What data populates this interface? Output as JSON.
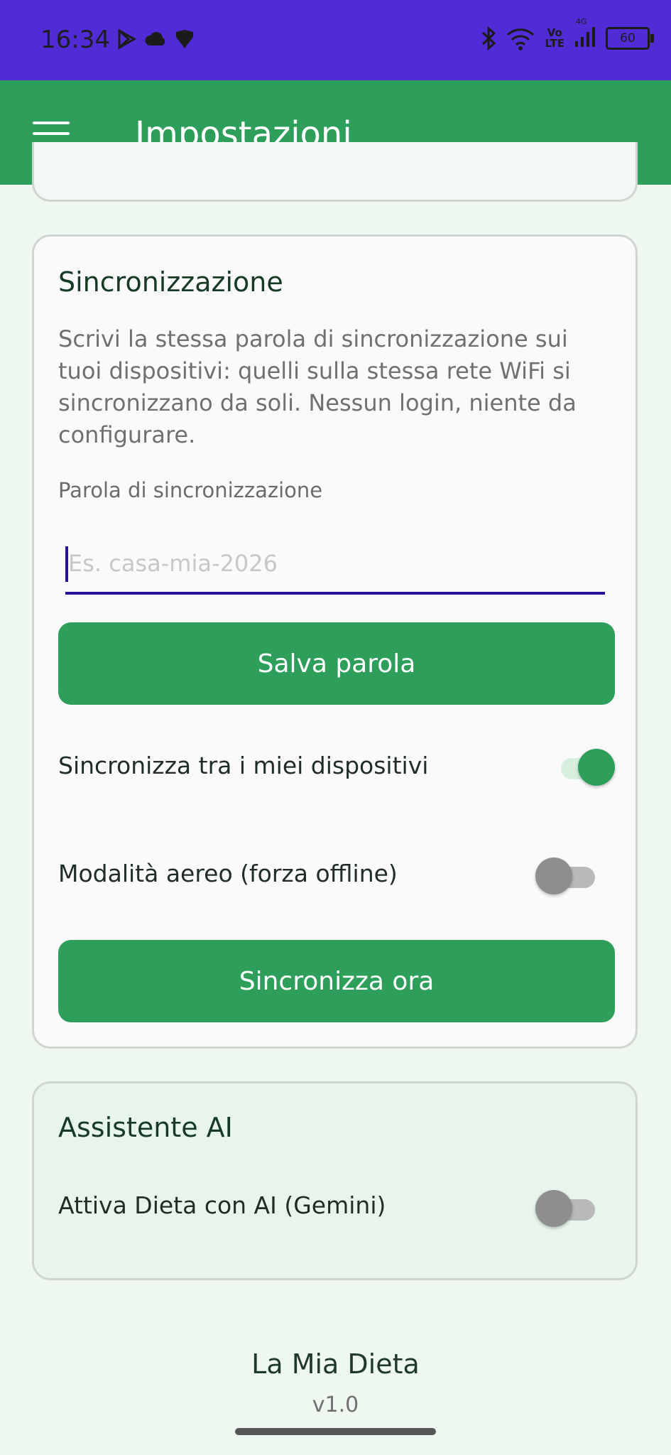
{
  "status_bar": {
    "time": "16:34",
    "battery": "60",
    "network_small": "4G",
    "network_top": "Vo",
    "network_bottom": "LTE",
    "left_icons": [
      "play-store-icon",
      "cloud-icon",
      "app-icon"
    ],
    "right_icons": [
      "bluetooth-icon",
      "wifi-icon",
      "signal-icon",
      "battery-icon"
    ]
  },
  "app_bar": {
    "title": "Impostazioni",
    "menu_icon": "hamburger-menu-icon"
  },
  "sync_card": {
    "title": "Sincronizzazione",
    "description": "Scrivi la stessa parola di sincronizzazione sui tuoi dispositivi: quelli sulla stessa rete WiFi si sincronizzano da soli. Nessun login, niente da configurare.",
    "field_label": "Parola di sincronizzazione",
    "field_placeholder": "Es. casa-mia-2026",
    "field_value": "",
    "save_button": "Salva parola",
    "sync_toggle_label": "Sincronizza tra i miei dispositivi",
    "sync_toggle_on": true,
    "airplane_toggle_label": "Modalità aereo (forza offline)",
    "airplane_toggle_on": false,
    "sync_now_button": "Sincronizza ora"
  },
  "ai_card": {
    "title": "Assistente AI",
    "ai_toggle_label": "Attiva Dieta con AI (Gemini)",
    "ai_toggle_on": false
  },
  "footer": {
    "app_name": "La Mia Dieta",
    "version": "v1.0"
  },
  "colors": {
    "status_bar": "#512cd6",
    "primary": "#2e9f5a",
    "background": "#eef7f0",
    "input_underline": "#2a119c"
  }
}
